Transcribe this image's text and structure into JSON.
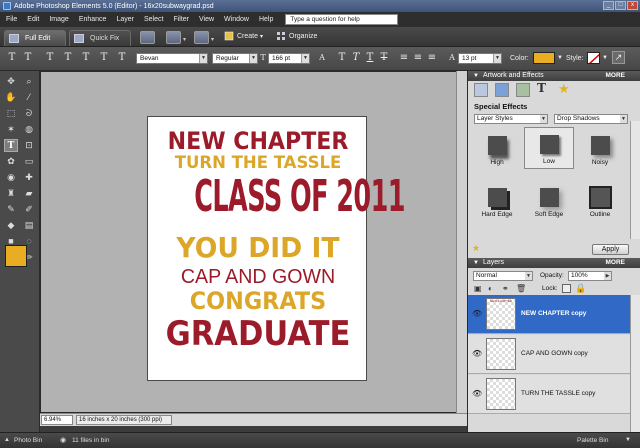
{
  "window": {
    "title": "Adobe Photoshop Elements 5.0 (Editor) - 16x20subwaygrad.psd",
    "min": "_",
    "max": "□",
    "close": "x"
  },
  "menu": [
    "File",
    "Edit",
    "Image",
    "Enhance",
    "Layer",
    "Select",
    "Filter",
    "View",
    "Window",
    "Help"
  ],
  "help_placeholder": "Type a question for help",
  "tabs": {
    "full_edit": "Full Edit",
    "quick_fix": "Quick Fix"
  },
  "shortcuts": {
    "create": "Create",
    "organize": "Organize"
  },
  "options": {
    "font_family": "Bevan",
    "font_style": "Regular",
    "font_size": "166 pt",
    "leading": "13 pt",
    "color_label": "Color:",
    "style_label": "Style:",
    "color_value": "#e8ad22",
    "text_glyph": "T"
  },
  "document": {
    "lines": [
      {
        "text": "NEW CHAPTER",
        "color": "#9b1b2a"
      },
      {
        "text": "TURN THE TASSLE",
        "color": "#dca628"
      },
      {
        "text": "CLASS OF 2011",
        "color": "#9b1b2a"
      },
      {
        "text": "YOU DID IT",
        "color": "#dca628"
      },
      {
        "text": "CAP AND GOWN",
        "color": "#9b1b2a"
      },
      {
        "text": "CONGRATS",
        "color": "#dca628"
      },
      {
        "text": "GRADUATE",
        "color": "#9b1b2a"
      }
    ]
  },
  "status": {
    "zoom": "6.94%",
    "doc_size": "16 inches x 20 inches (300 ppi)"
  },
  "artwork_panel": {
    "title": "Artwork and Effects",
    "more": "MORE",
    "section": "Special Effects",
    "category": "Layer Styles",
    "subcategory": "Drop Shadows",
    "thumbs": [
      "High",
      "Low",
      "Noisy",
      "Hard Edge",
      "Soft Edge",
      "Outline"
    ],
    "apply": "Apply"
  },
  "layers_panel": {
    "title": "Layers",
    "more": "MORE",
    "blend_mode": "Normal",
    "opacity_label": "Opacity:",
    "opacity": "100%",
    "lock_label": "Lock:",
    "rows": [
      {
        "name": "NEW CHAPTER copy",
        "thumb": "NEW CHAPTER"
      },
      {
        "name": "CAP AND GOWN copy",
        "thumb": ""
      },
      {
        "name": "TURN THE TASSLE copy",
        "thumb": ""
      }
    ]
  },
  "bottom": {
    "photo_bin": "Photo Bin",
    "files_in_bin": "11 files in bin",
    "palette_bin": "Palette Bin"
  },
  "colors": {
    "foreground": "#e8ad22",
    "background": "#f0a0a8"
  }
}
